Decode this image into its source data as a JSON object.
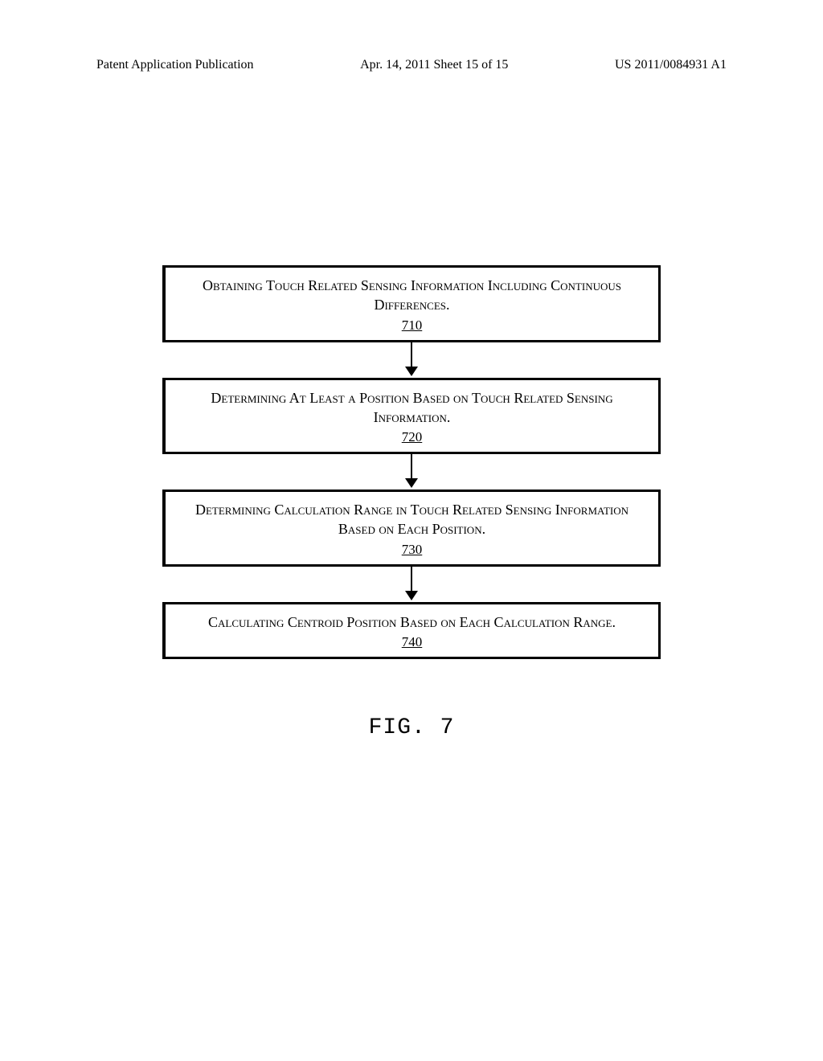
{
  "header": {
    "left": "Patent Application Publication",
    "center": "Apr. 14, 2011  Sheet 15 of 15",
    "right": "US 2011/0084931 A1"
  },
  "flow": {
    "steps": [
      {
        "text": "Obtaining Touch Related Sensing Information Including Continuous Differences.",
        "num": "710"
      },
      {
        "text": "Determining At Least a Position Based on Touch Related Sensing Information.",
        "num": "720"
      },
      {
        "text": "Determining Calculation Range in Touch Related Sensing Information Based on Each Position.",
        "num": "730"
      },
      {
        "text": "Calculating Centroid Position Based on Each Calculation Range.",
        "num": "740"
      }
    ]
  },
  "figure_label": "FIG. 7"
}
